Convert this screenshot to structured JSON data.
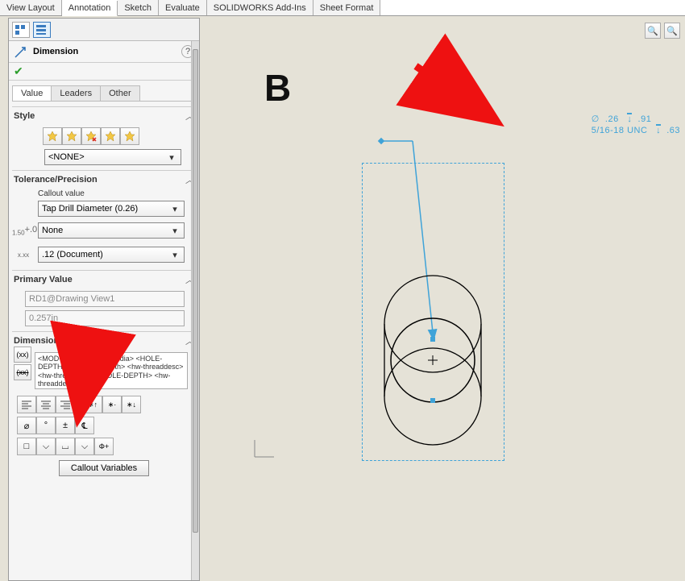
{
  "ribbon": {
    "tabs": [
      "View Layout",
      "Annotation",
      "Sketch",
      "Evaluate",
      "SOLIDWORKS Add-Ins",
      "Sheet Format"
    ],
    "active": "Annotation"
  },
  "panel": {
    "title": "Dimension",
    "subtabs": {
      "active": "Value",
      "items": [
        "Value",
        "Leaders",
        "Other"
      ]
    }
  },
  "style": {
    "head": "Style",
    "selected": "<NONE>"
  },
  "tolerance": {
    "head": "Tolerance/Precision",
    "callout_label": "Callout value",
    "callout_value": "Tap Drill Diameter (0.26)",
    "tolerance_type": "None",
    "precision": ".12 (Document)"
  },
  "primary": {
    "head": "Primary Value",
    "name": "RD1@Drawing View1",
    "value": "0.257in"
  },
  "dim_text": {
    "head": "Dimension Text",
    "template": "<MOD-DIAM> <hw-tapdrldia> <HOLE-DEPTH> <hw-tapdrldepth>\n<hw-threaddesc> <hw-threadclass> <HOLE-DEPTH> <hw-threaddepth>",
    "callout_btn": "Callout Variables"
  },
  "canvas": {
    "view_letter": "B",
    "callout_line1_diam": ".26",
    "callout_line1_depth": ".91",
    "callout_line2_thread": "5/16-18 UNC",
    "callout_line2_depth": ".63"
  }
}
